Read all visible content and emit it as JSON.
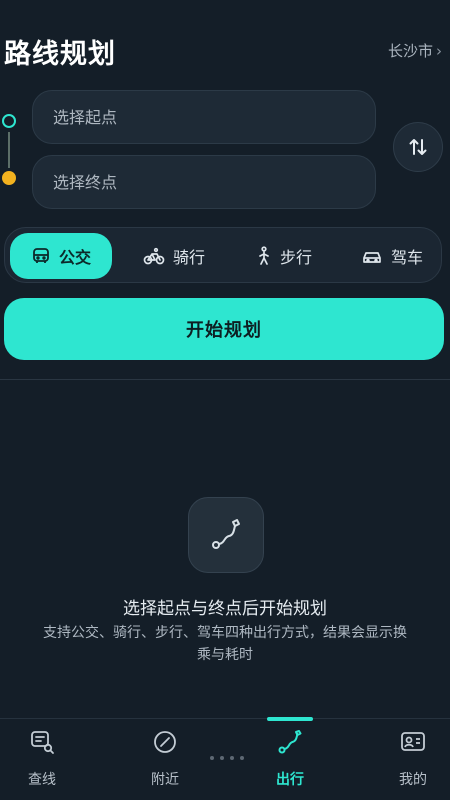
{
  "header": {
    "title": "路线规划",
    "city": "长沙市",
    "city_chevron": "›"
  },
  "route": {
    "start_placeholder": "选择起点",
    "end_placeholder": "选择终点",
    "swap_icon": "swap-vertical-icon"
  },
  "modes": [
    {
      "label": "公交",
      "icon": "bus-icon",
      "active": true
    },
    {
      "label": "骑行",
      "icon": "bike-icon",
      "active": false
    },
    {
      "label": "步行",
      "icon": "walk-icon",
      "active": false
    },
    {
      "label": "驾车",
      "icon": "car-icon",
      "active": false
    }
  ],
  "start_button": {
    "label": "开始规划"
  },
  "empty_state": {
    "icon": "route-icon",
    "title": "选择起点与终点后开始规划",
    "description": "支持公交、骑行、步行、驾车四种出行方式，结果会显示换乘与耗时"
  },
  "bottom_nav": [
    {
      "label": "查线",
      "icon": "line-search-icon",
      "active": false
    },
    {
      "label": "附近",
      "icon": "compass-icon",
      "active": false
    },
    {
      "label": "出行",
      "icon": "route-icon",
      "active": true
    },
    {
      "label": "我的",
      "icon": "profile-icon",
      "active": false
    }
  ],
  "colors": {
    "accent": "#2ee6d0",
    "start_dot": "#2ee6d0",
    "end_dot": "#f3b21f",
    "background": "#141e28"
  }
}
